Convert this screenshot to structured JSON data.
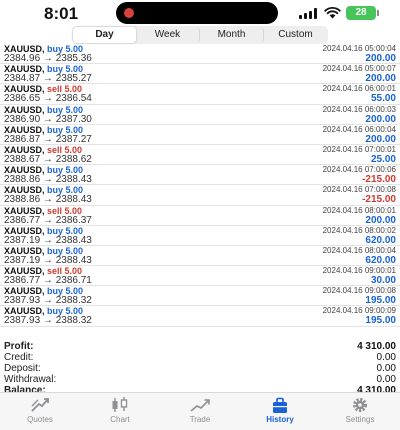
{
  "status": {
    "time": "8:01",
    "battery": "28"
  },
  "segments": [
    {
      "label": "Day",
      "active": true
    },
    {
      "label": "Week",
      "active": false
    },
    {
      "label": "Month",
      "active": false
    },
    {
      "label": "Custom",
      "active": false
    }
  ],
  "deals": [
    {
      "symbol": "XAUUSD,",
      "side": "buy",
      "side_label": "buy 5.00",
      "time": "2024.04.16 05:00:04",
      "prices": "2384.96 → 2385.36",
      "profit": "200.00"
    },
    {
      "symbol": "XAUUSD,",
      "side": "buy",
      "side_label": "buy 5.00",
      "time": "2024.04.16 05:00:07",
      "prices": "2384.87 → 2385.27",
      "profit": "200.00"
    },
    {
      "symbol": "XAUUSD,",
      "side": "sell",
      "side_label": "sell 5.00",
      "time": "2024.04.16 06:00:01",
      "prices": "2386.65 → 2386.54",
      "profit": "55.00"
    },
    {
      "symbol": "XAUUSD,",
      "side": "buy",
      "side_label": "buy 5.00",
      "time": "2024.04.16 06:00:03",
      "prices": "2386.90 → 2387.30",
      "profit": "200.00"
    },
    {
      "symbol": "XAUUSD,",
      "side": "buy",
      "side_label": "buy 5.00",
      "time": "2024.04.16 06:00:04",
      "prices": "2386.87 → 2387.27",
      "profit": "200.00"
    },
    {
      "symbol": "XAUUSD,",
      "side": "sell",
      "side_label": "sell 5.00",
      "time": "2024.04.16 07:00:01",
      "prices": "2388.67 → 2388.62",
      "profit": "25.00"
    },
    {
      "symbol": "XAUUSD,",
      "side": "buy",
      "side_label": "buy 5.00",
      "time": "2024.04.16 07:00:06",
      "prices": "2388.86 → 2388.43",
      "profit": "-215.00"
    },
    {
      "symbol": "XAUUSD,",
      "side": "buy",
      "side_label": "buy 5.00",
      "time": "2024.04.16 07:00:08",
      "prices": "2388.86 → 2388.43",
      "profit": "-215.00"
    },
    {
      "symbol": "XAUUSD,",
      "side": "sell",
      "side_label": "sell 5.00",
      "time": "2024.04.16 08:00:01",
      "prices": "2386.77 → 2386.37",
      "profit": "200.00"
    },
    {
      "symbol": "XAUUSD,",
      "side": "buy",
      "side_label": "buy 5.00",
      "time": "2024.04.16 08:00:02",
      "prices": "2387.19 → 2388.43",
      "profit": "620.00"
    },
    {
      "symbol": "XAUUSD,",
      "side": "buy",
      "side_label": "buy 5.00",
      "time": "2024.04.16 08:00:04",
      "prices": "2387.19 → 2388.43",
      "profit": "620.00"
    },
    {
      "symbol": "XAUUSD,",
      "side": "sell",
      "side_label": "sell 5.00",
      "time": "2024.04.16 09:00:01",
      "prices": "2386.77 → 2386.71",
      "profit": "30.00"
    },
    {
      "symbol": "XAUUSD,",
      "side": "buy",
      "side_label": "buy 5.00",
      "time": "2024.04.16 09:00:08",
      "prices": "2387.93 → 2388.32",
      "profit": "195.00"
    },
    {
      "symbol": "XAUUSD,",
      "side": "buy",
      "side_label": "buy 5.00",
      "time": "2024.04.16 09:00:09",
      "prices": "2387.93 → 2388.32",
      "profit": "195.00"
    }
  ],
  "summary": {
    "profit_label": "Profit:",
    "profit_value": "4 310.00",
    "credit_label": "Credit:",
    "credit_value": "0.00",
    "deposit_label": "Deposit:",
    "deposit_value": "0.00",
    "withdrawal_label": "Withdrawal:",
    "withdrawal_value": "0.00",
    "balance_label": "Balance:",
    "balance_value": "4 310.00"
  },
  "tabs": [
    {
      "label": "Quotes",
      "icon": "quotes-icon",
      "active": false
    },
    {
      "label": "Chart",
      "icon": "chart-icon",
      "active": false
    },
    {
      "label": "Trade",
      "icon": "trade-icon",
      "active": false
    },
    {
      "label": "History",
      "icon": "history-icon",
      "active": true
    },
    {
      "label": "Settings",
      "icon": "settings-icon",
      "active": false
    }
  ],
  "colors": {
    "buy": "#1a63d6",
    "sell": "#d03a2f",
    "active_tab": "#1a63d6",
    "battery": "#47c45a"
  }
}
